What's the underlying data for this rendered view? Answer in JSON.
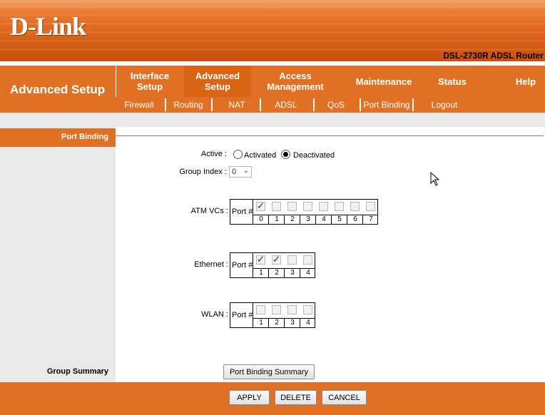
{
  "brand": {
    "logo": "D-Link",
    "model": "DSL-2730R ADSL Router"
  },
  "section_title": "Advanced Setup",
  "main_tabs": [
    {
      "label": "Interface Setup",
      "active": false
    },
    {
      "label": "Advanced Setup",
      "active": true
    },
    {
      "label": "Access Management",
      "active": false
    },
    {
      "label": "Maintenance",
      "active": false
    },
    {
      "label": "Status",
      "active": false
    },
    {
      "label": "Help",
      "active": false
    }
  ],
  "sub_tabs": [
    "Firewall",
    "Routing",
    "NAT",
    "ADSL",
    "QoS",
    "Port Binding",
    "Logout"
  ],
  "left": {
    "port_binding": "Port Binding",
    "group_summary": "Group Summary"
  },
  "form": {
    "active_label": "Active :",
    "active_options": [
      {
        "label": "Activated",
        "selected": false
      },
      {
        "label": "Deactivated",
        "selected": true
      }
    ],
    "group_index_label": "Group Index :",
    "group_index_value": "0",
    "atm": {
      "label": "ATM VCs :",
      "port_label": "Port #",
      "ports": [
        "0",
        "1",
        "2",
        "3",
        "4",
        "5",
        "6",
        "7"
      ],
      "checked": [
        true,
        false,
        false,
        false,
        false,
        false,
        false,
        false
      ]
    },
    "ethernet": {
      "label": "Ethernet :",
      "port_label": "Port #",
      "ports": [
        "1",
        "2",
        "3",
        "4"
      ],
      "checked": [
        true,
        true,
        false,
        false
      ]
    },
    "wlan": {
      "label": "WLAN :",
      "port_label": "Port #",
      "ports": [
        "1",
        "2",
        "3",
        "4"
      ],
      "checked": [
        false,
        false,
        false,
        false
      ]
    },
    "summary_button": "Port Binding Summary"
  },
  "buttons": {
    "apply": "APPLY",
    "delete": "DELETE",
    "cancel": "CANCEL"
  },
  "colors": {
    "accent": "#e07124",
    "panel": "#e9e9e9"
  },
  "icons": {
    "cursor": "mouse-pointer-icon",
    "select": "chevron-down-icon"
  }
}
